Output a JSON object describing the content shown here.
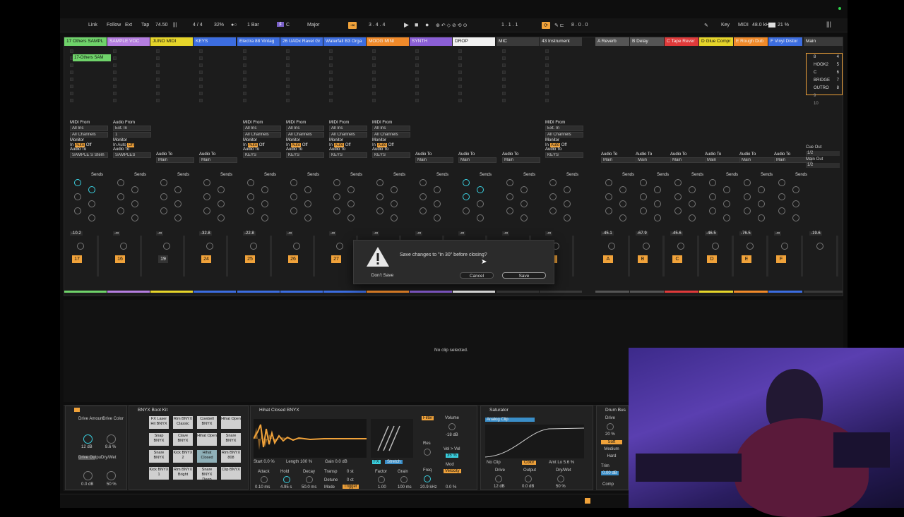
{
  "transport": {
    "link": "Link",
    "follow": "Follow",
    "ext": "Ext",
    "tap": "Tap",
    "tempo": "74.50",
    "meter": "4 / 4",
    "zoom": "32%",
    "quant": "1 Bar",
    "key": "C",
    "scale": "Major",
    "pos": "3 .  4 .  4",
    "pos2": "1 .  1 .  1",
    "pos3": "8 .  0 .  0",
    "key_label": "Key",
    "midi_label": "MIDI",
    "rate": "48.0 kHz",
    "cpu": "21 %"
  },
  "tracks": [
    {
      "name": "17 Others SAMPL",
      "color": "#6fd36a",
      "num": "17",
      "db": "-10.2"
    },
    {
      "name": "SAMPLE VOC",
      "color": "#b57ee0",
      "num": "16",
      "db": "-∞"
    },
    {
      "name": "JUNO MIDI",
      "color": "#e6d52a",
      "num": "19",
      "db": "-∞"
    },
    {
      "name": "KEYS",
      "color": "#3c6de0",
      "num": "24",
      "db": "-32.8"
    },
    {
      "name": "Electra 88 Vintag",
      "color": "#3c6de0",
      "num": "25",
      "db": "-22.8"
    },
    {
      "name": "26 UADx Ravel Gr",
      "color": "#3c6de0",
      "num": "26",
      "db": "-∞"
    },
    {
      "name": "Waterfall B3 Orga",
      "color": "#3c6de0",
      "num": "27",
      "db": "-∞"
    },
    {
      "name": "MOOG MINI",
      "color": "#f08a2a",
      "num": "28",
      "db": "-∞"
    },
    {
      "name": "SYNTH",
      "color": "#8b5fd6",
      "num": "29",
      "db": "-∞"
    },
    {
      "name": "DROP",
      "color": "#f2f2f2",
      "num": "30",
      "db": "-∞"
    },
    {
      "name": "MIC",
      "color": "#3a3a3a",
      "num": "31",
      "db": "-∞"
    },
    {
      "name": "43 Instrument",
      "color": "#3a3a3a",
      "num": "3",
      "db": "-∞"
    },
    {
      "name": "A Reverb",
      "color": "#555",
      "num": "A",
      "db": "-45.1"
    },
    {
      "name": "B Delay",
      "color": "#555",
      "num": "B",
      "db": "-67.9"
    },
    {
      "name": "C Tape Rever",
      "color": "#e03a3a",
      "num": "C",
      "db": "-45.6"
    },
    {
      "name": "D Glue Compr",
      "color": "#e6d52a",
      "num": "D",
      "db": "-46.5"
    },
    {
      "name": "E Rough Dub",
      "color": "#f08a2a",
      "num": "E",
      "db": "-76.5"
    },
    {
      "name": "F Vinyl Distor",
      "color": "#3c6de0",
      "num": "F",
      "db": "-∞"
    },
    {
      "name": "Main",
      "color": "#3a3a3a",
      "num": "",
      "db": "-19.6"
    }
  ],
  "clip_name": "17-Others SAM",
  "io": {
    "midi_from": "MIDI From",
    "all_ins": "All Ins",
    "all_channels": "All Channels",
    "monitor": "Monitor",
    "in": "In",
    "auto": "Auto",
    "off": "Off",
    "audio_to": "Audio To",
    "main": "Main",
    "keys": "KEYS",
    "samples": "SAMPLES",
    "sample_s": "SAMPLE S Stem",
    "audio_from": "Audio From",
    "ext_in": "Ext. In",
    "sends": "Sends",
    "cue_out": "Cue Out",
    "main_out": "Main Out",
    "half": "1/2",
    "one": "1",
    "two": "2"
  },
  "scenes": [
    "8",
    "HOOK2",
    "C",
    "BRIDGE",
    "OUTRO",
    "9",
    "10"
  ],
  "scene_nums": [
    "4",
    "5",
    "6",
    "7",
    "8"
  ],
  "dialog": {
    "message": "Save changes to \"in 30\" before closing?",
    "dont_save": "Don't Save",
    "cancel": "Cancel",
    "save": "Save"
  },
  "detail": {
    "no_clip": "No clip selected."
  },
  "devices": {
    "drum_rack": "BNYX Boot Kit",
    "sampler": "Hihat Closed BNYX",
    "saturator": "Saturator",
    "drum_bus": "Drum Bus",
    "drive_amount": "Drive Amount",
    "drive_color": "Drive Color",
    "drive_output": "Drive Output",
    "dry_wet": "Dry/Wet",
    "val_12db": "12 dB",
    "val_86": "8.6 %",
    "val_0db": "0.0 dB",
    "val_50": "50 %",
    "pads": [
      "FX Laser Hit BNYX",
      "Rim BNYX Classic",
      "Cowbell BNYX",
      "Hihat Open",
      "Snap BNYX",
      "Clave BNYX",
      "Hihat Open",
      "Snare BNYX",
      "Snare BNYX",
      "Kick BNYX 2",
      "Hihat Closed",
      "Rim BNYX 808",
      "Kick BNYX 1",
      "Rim BNYX Bright",
      "Snare BNYX Deep",
      "Clip BNYX"
    ],
    "start": "Start",
    "start_val": "0.0 %",
    "length": "Length",
    "length_val": "100 %",
    "gain": "Gain",
    "gain_val": "0.0 dB",
    "attack": "Attack",
    "hold": "Hold",
    "decay": "Decay",
    "transp": "Transp",
    "detune": "Detune",
    "mode": "Mode",
    "trigger": "Trigger",
    "attack_val": "0.10 ms",
    "hold_val": "4.95 s",
    "decay_val": "50.0 ms",
    "transp_val": "0 st",
    "detune_val": "0 ct",
    "factor": "Factor",
    "grain": "Grain",
    "factor_val": "1.00",
    "grain_val": "100 ms",
    "fx": "FX",
    "stretch": "Stretch",
    "filter": "Filter",
    "volume": "Volume",
    "vol_val": "-18 dB",
    "res": "Res",
    "freq": "Freq",
    "freq_val": "20.9 kHz",
    "velvol": "Vel > Vol",
    "vel_val": "35 %",
    "mod": "Mod",
    "velocity": "Velocity",
    "pct0": "0.0 %",
    "analog_clip": "Analog Clip",
    "no_clip": "No Clip",
    "color": "Color",
    "amt_lo": "Amt Lo",
    "amt_val": "5.6 %",
    "drive": "Drive",
    "output": "Output",
    "drywet": "Dry/Wet",
    "d12": "12 dB",
    "o0": "0.0 dB",
    "dw": "50 %",
    "db_drive": "Drive",
    "db_20": "20 %",
    "soft": "Soft",
    "medium": "Medium",
    "hard": "Hard",
    "trim": "Trim",
    "trim_val": "0.00 dB",
    "comp": "Comp"
  },
  "accent": "#f0a23a"
}
